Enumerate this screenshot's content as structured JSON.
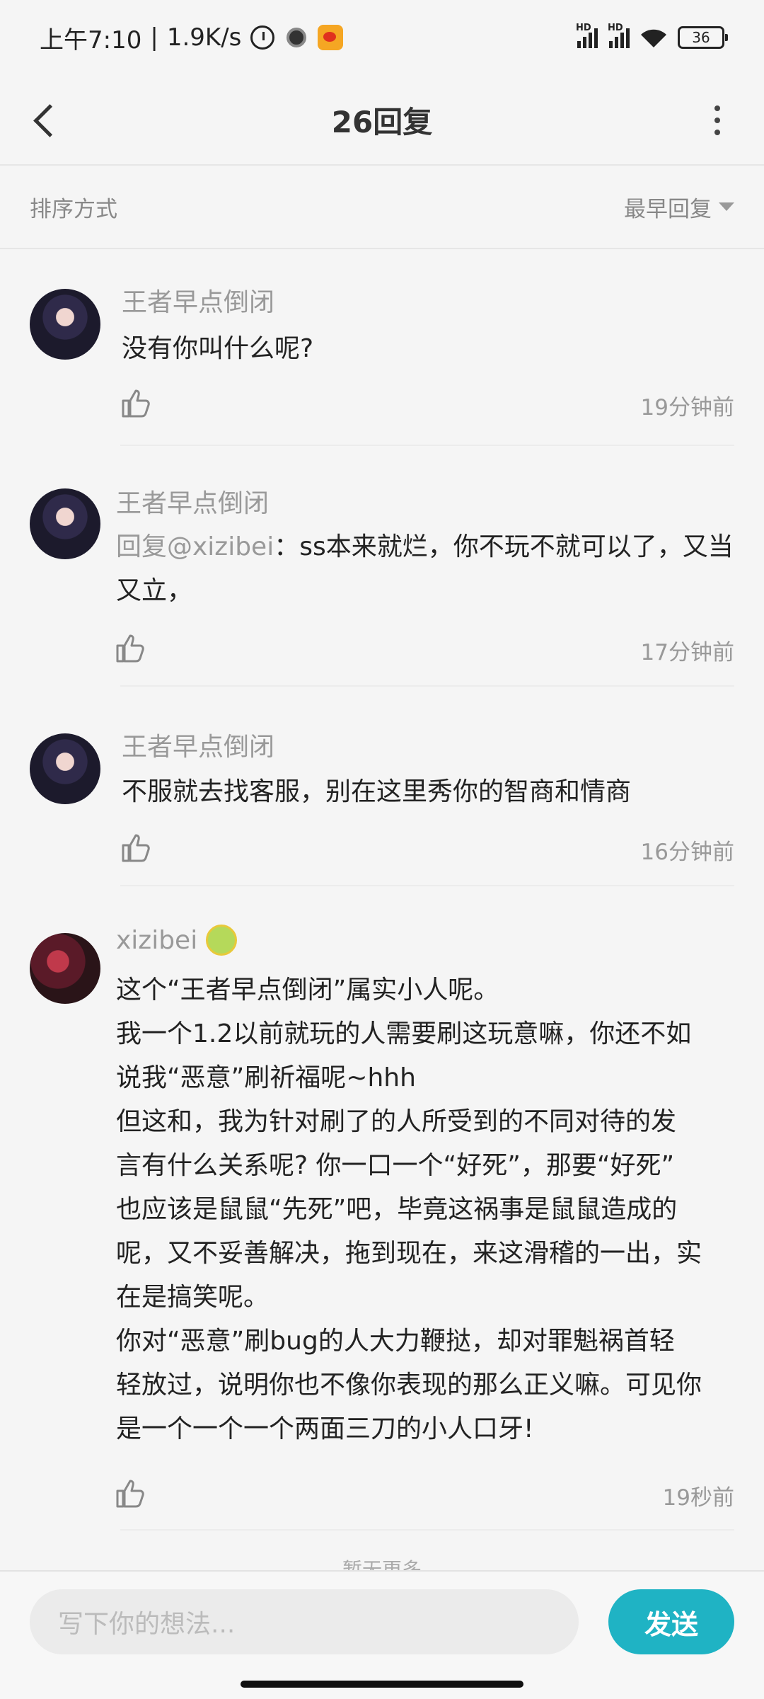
{
  "status_bar": {
    "time": "上午7:10",
    "separator": "|",
    "net_speed": "1.9K/s",
    "signal_label_1": "HD",
    "signal_label_2": "HD",
    "battery": "36",
    "icons": [
      "alarm-icon",
      "record-icon",
      "weibo-icon",
      "signal-icon",
      "signal-icon",
      "wifi-icon",
      "battery-icon"
    ]
  },
  "header": {
    "title": "26回复"
  },
  "sort": {
    "label": "排序方式",
    "value": "最早回复"
  },
  "comments": [
    {
      "author": "王者早点倒闭",
      "text": "没有你叫什么呢?",
      "time": "19分钟前"
    },
    {
      "author": "王者早点倒闭",
      "mention": "回复@xizibei",
      "text": "：ss本来就烂，你不玩不就可以了，又当又立，",
      "time": "17分钟前"
    },
    {
      "author": "王者早点倒闭",
      "text": "不服就去找客服，别在这里秀你的智商和情商",
      "time": "16分钟前"
    },
    {
      "author": "xizibei",
      "lines": [
        "这个“王者早点倒闭”属实小人呢。",
        "我一个1.2以前就玩的人需要刷这玩意嘛，你还不如",
        "说我“恶意”刷祈福呢~hhh",
        "但这和，我为针对刷了的人所受到的不同对待的发",
        "言有什么关系呢? 你一口一个“好死”，那要“好死”",
        "也应该是鼠鼠“先死”吧，毕竟这祸事是鼠鼠造成的",
        "呢，又不妥善解决，拖到现在，来这滑稽的一出，实",
        "在是搞笑呢。",
        "你对“恶意”刷bug的人大力鞭挞，却对罪魁祸首轻",
        "轻放过，说明你也不像你表现的那么正义嘛。可见你",
        "是一个一个一个两面三刀的小人口牙!"
      ],
      "time": "19秒前"
    }
  ],
  "load_more": "暂无更多",
  "composer": {
    "placeholder": "写下你的想法...",
    "send_label": "发送"
  },
  "colors": {
    "accent": "#1fb3c4",
    "background": "#f5f5f5",
    "secondary_text": "#999999"
  }
}
